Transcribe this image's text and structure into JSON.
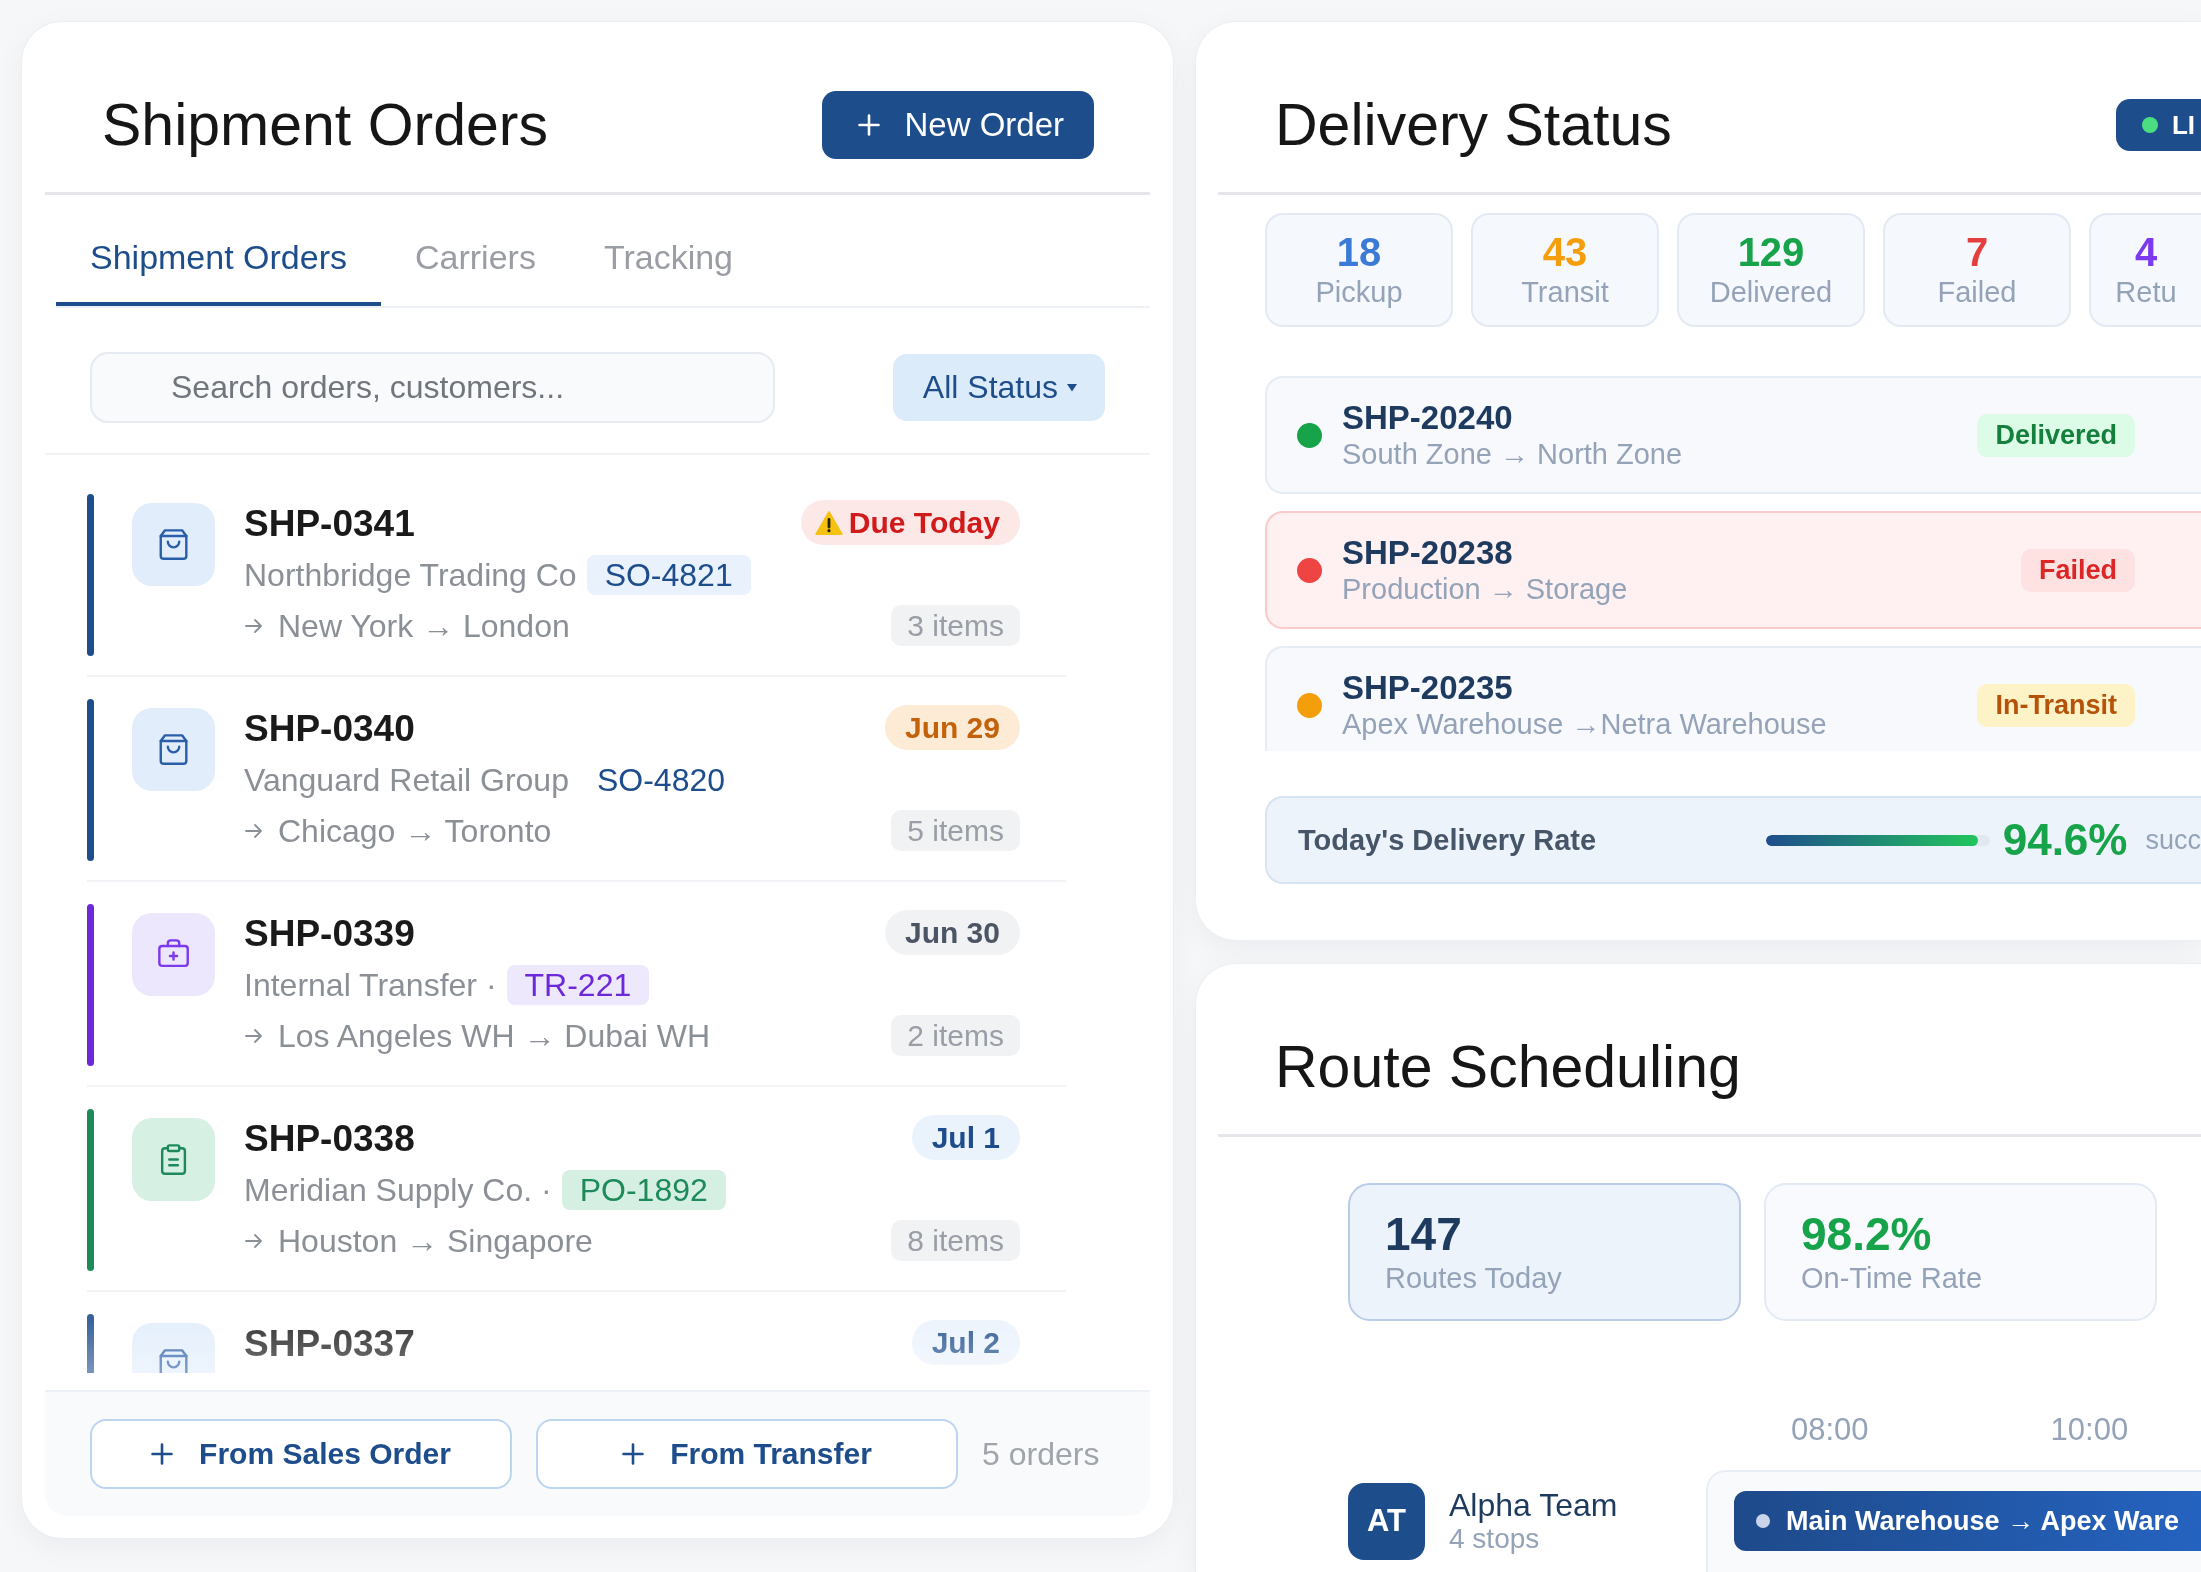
{
  "shipment_orders": {
    "title": "Shipment Orders",
    "new_button": {
      "label": "New Order"
    },
    "tabs": [
      {
        "label": "Shipment Orders",
        "selected": true
      },
      {
        "label": "Carriers",
        "selected": false
      },
      {
        "label": "Tracking",
        "selected": false
      }
    ],
    "search": {
      "placeholder": "Search orders, customers..."
    },
    "status_filter": {
      "label": "All Status"
    },
    "orders": [
      {
        "kind": "sales",
        "id": "SHP-0341",
        "customer": "Northbridge Trading Co",
        "reference": {
          "text": "SO-4821",
          "filled": true
        },
        "route": "New York → London",
        "due": {
          "text": "Due Today",
          "kind": "urgent"
        },
        "items": "3 items"
      },
      {
        "kind": "sales",
        "id": "SHP-0340",
        "customer": "Vanguard Retail Group",
        "reference": {
          "text": "SO-4820",
          "filled": false
        },
        "route": "Chicago → Toronto",
        "due": {
          "text": "Jun 29",
          "kind": "soon"
        },
        "items": "5 items"
      },
      {
        "kind": "transfer",
        "id": "SHP-0339",
        "customer": "Internal Transfer ·",
        "reference": {
          "text": "TR-221",
          "filled": true
        },
        "route": "Los Angeles WH → Dubai WH",
        "due": {
          "text": "Jun 30",
          "kind": "neutral"
        },
        "items": "2 items"
      },
      {
        "kind": "purchase",
        "id": "SHP-0338",
        "customer": "Meridian Supply Co. ·",
        "reference": {
          "text": "PO-1892",
          "filled": true
        },
        "route": "Houston → Singapore",
        "due": {
          "text": "Jul 1",
          "kind": "upcoming"
        },
        "items": "8 items"
      },
      {
        "kind": "sales",
        "id": "SHP-0337",
        "due": {
          "text": "Jul 2",
          "kind": "upcoming"
        }
      }
    ],
    "footer": {
      "buttons": [
        {
          "label": "From Sales Order"
        },
        {
          "label": "From Transfer"
        }
      ],
      "count": "5 orders"
    }
  },
  "delivery_status": {
    "title": "Delivery Status",
    "live_badge": {
      "label": "LI"
    },
    "stats": [
      {
        "value": "18",
        "label": "Pickup",
        "color": "#3b7bd6"
      },
      {
        "value": "43",
        "label": "Transit",
        "color": "#f59e0b"
      },
      {
        "value": "129",
        "label": "Delivered",
        "color": "#16a34a"
      },
      {
        "value": "7",
        "label": "Failed",
        "color": "#e53e3e"
      },
      {
        "value": "4",
        "label": "Retu",
        "color": "#7c3aed"
      }
    ],
    "shipments": [
      {
        "kind": "delivered",
        "id": "SHP-20240",
        "route": "South Zone → North Zone",
        "status": "Delivered"
      },
      {
        "kind": "failed",
        "id": "SHP-20238",
        "route": "Production → Storage",
        "status": "Failed"
      },
      {
        "kind": "in_transit",
        "id": "SHP-20235",
        "route": "Apex Warehouse →Netra Warehouse",
        "status": "In-Transit"
      }
    ],
    "rate": {
      "label": "Today's Delivery Rate",
      "level": 0.946,
      "value": "94.6%",
      "caption": "succ"
    }
  },
  "route_scheduling": {
    "title": "Route Scheduling",
    "stats": [
      {
        "value": "147",
        "label": "Routes Today",
        "color": "#1e3a5f",
        "selected": true
      },
      {
        "value": "98.2%",
        "label": "On-Time Rate",
        "color": "#16a34a",
        "selected": false
      }
    ],
    "time_axis": [
      "08:00",
      "10:00"
    ],
    "teams": [
      {
        "initials": "AT",
        "name": "Alpha Team",
        "stops": "4 stops",
        "route": "Main Warehouse → Apex Ware"
      }
    ]
  }
}
